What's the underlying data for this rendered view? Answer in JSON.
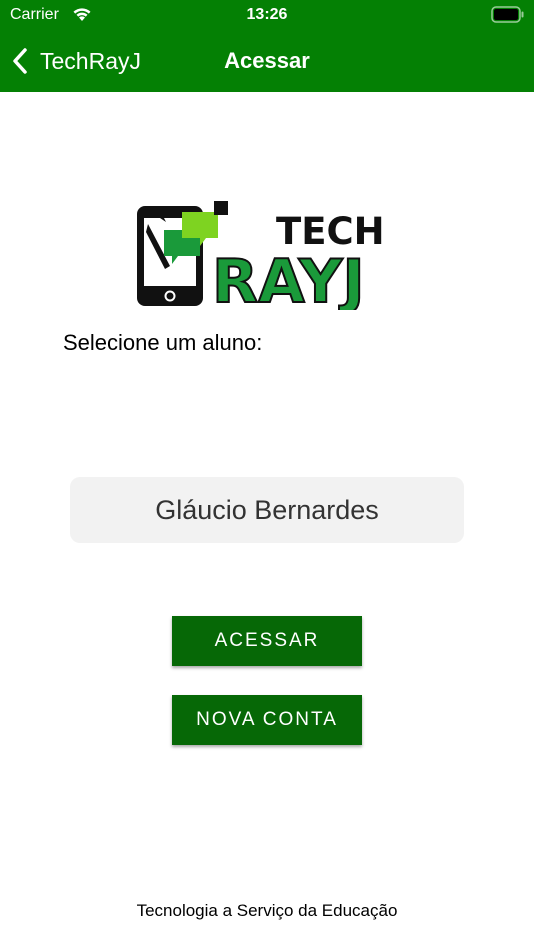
{
  "status_bar": {
    "carrier": "Carrier",
    "time": "13:26",
    "icons": [
      "wifi-icon",
      "battery-icon"
    ]
  },
  "nav": {
    "back_label": "TechRayJ",
    "back_icon": "chevron-left-icon",
    "title": "Acessar"
  },
  "logo": {
    "line1": "TECH",
    "line2": "RAYJ"
  },
  "main": {
    "select_label": "Selecione um aluno:",
    "selected_student": "Gláucio Bernardes"
  },
  "buttons": {
    "acessar": "ACESSAR",
    "nova_conta": "NOVA CONTA"
  },
  "footer": {
    "tagline": "Tecnologia a Serviço da Educação"
  },
  "colors": {
    "header_green": "#048004",
    "button_green": "#066806",
    "logo_green": "#1a9a3a",
    "logo_bubble_green": "#7ed321",
    "picker_bg": "#f2f2f2"
  }
}
